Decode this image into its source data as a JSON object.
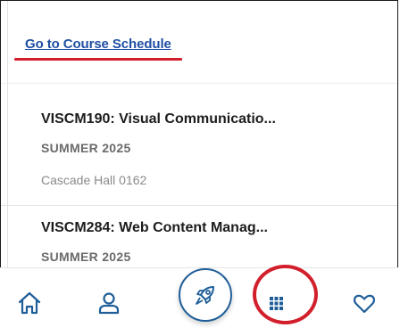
{
  "header": {
    "schedule_link": "Go to Course Schedule"
  },
  "courses": [
    {
      "title": "VISCM190: Visual Communicatio...",
      "term": "SUMMER 2025",
      "location": "Cascade Hall 0162"
    },
    {
      "title": "VISCM284: Web Content Manag...",
      "term": "SUMMER 2025"
    }
  ],
  "tabbar": {
    "items": [
      {
        "name": "home",
        "icon": "home-icon"
      },
      {
        "name": "profile",
        "icon": "person-icon"
      },
      {
        "name": "launch",
        "icon": "rocket-icon"
      },
      {
        "name": "apps",
        "icon": "grid-icon"
      },
      {
        "name": "favorites",
        "icon": "heart-icon"
      }
    ]
  },
  "colors": {
    "link": "#1f4fa3",
    "accent_blue": "#1f5e99",
    "annotation_red": "#d21f2b"
  }
}
